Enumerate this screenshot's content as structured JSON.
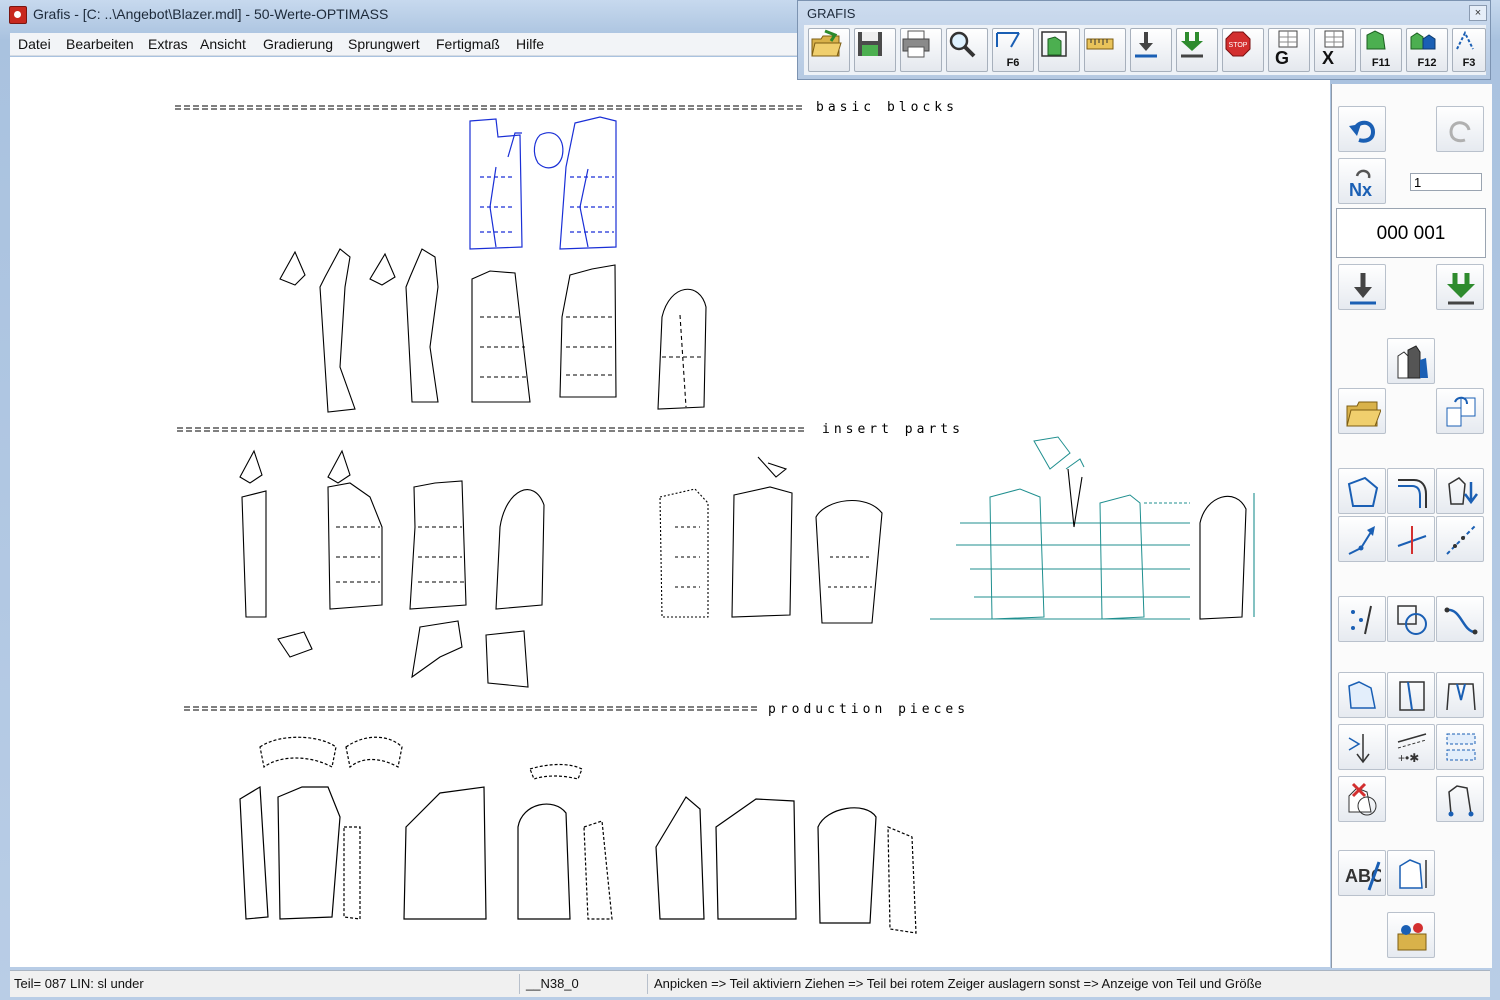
{
  "window": {
    "title": "Grafis - [C: ..\\Angebot\\Blazer.mdl] - 50-Werte-OPTIMASS"
  },
  "menu": [
    "Datei",
    "Bearbeiten",
    "Extras",
    "Ansicht",
    "Gradierung",
    "Sprungwert",
    "Fertigmaß",
    "Hilfe"
  ],
  "toolbar": {
    "title": "GRAFIS",
    "close": "×",
    "buttons": [
      {
        "icon": "open-folder-icon",
        "label": ""
      },
      {
        "icon": "save-icon",
        "label": ""
      },
      {
        "icon": "print-icon",
        "label": ""
      },
      {
        "icon": "zoom-icon",
        "label": ""
      },
      {
        "icon": "f6-tool-icon",
        "label": "F6"
      },
      {
        "icon": "part-frame-icon",
        "label": ""
      },
      {
        "icon": "measure-tape-icon",
        "label": ""
      },
      {
        "icon": "download-arrow-icon",
        "label": ""
      },
      {
        "icon": "download-multi-icon",
        "label": ""
      },
      {
        "icon": "stop-icon",
        "label": ""
      },
      {
        "icon": "g-table-icon",
        "label": "G"
      },
      {
        "icon": "x-table-icon",
        "label": "X"
      },
      {
        "icon": "f11-icon",
        "label": "F11"
      },
      {
        "icon": "f12-icon",
        "label": "F12"
      },
      {
        "icon": "f3-icon",
        "label": "F3"
      }
    ]
  },
  "canvas": {
    "sections": [
      "basic blocks",
      "insert parts",
      "production pieces"
    ],
    "divider": "=========================================================="
  },
  "side_panel": {
    "repeat_value": "1",
    "counter": "000 001",
    "tools": [
      "undo-icon",
      "redo-icon",
      "repeat-nx-icon",
      "download-arrow-icon",
      "download-multi-icon",
      "part-set-icon",
      "open-folder-icon",
      "copy-part-icon",
      "shape-icon",
      "curve-corner-icon",
      "move-down-icon",
      "line-arrow-icon",
      "perpendicular-icon",
      "dotted-line-icon",
      "points-icon",
      "circle-icon",
      "curve-icon",
      "pattern-piece-icon",
      "panel-icon",
      "dart-icon",
      "grain-arrow-icon",
      "notch-icon",
      "seam-icon",
      "delete-part-icon",
      "contour-icon",
      "text-abc-icon",
      "piece-measure-icon",
      "sewing-kit-icon"
    ]
  },
  "status": {
    "part": "Teil= 087  LIN: sl under",
    "size": "__N38_0",
    "hint": "Anpicken => Teil aktiviern Ziehen => Teil bei rotem Zeiger auslagern sonst => Anzeige von Teil und Größe"
  }
}
